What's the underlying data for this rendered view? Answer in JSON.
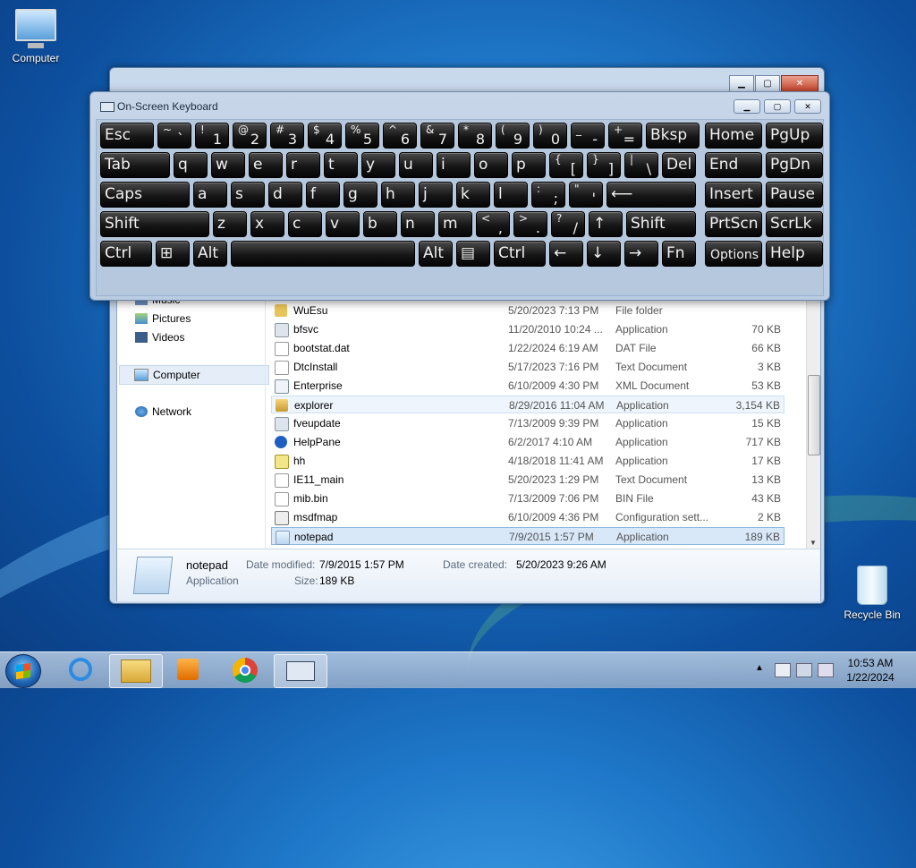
{
  "desktop": {
    "computer_label": "Computer",
    "recycle_bin_label": "Recycle Bin"
  },
  "explorer": {
    "nav": [
      "Music",
      "Pictures",
      "Videos",
      "Computer",
      "Network"
    ],
    "files": [
      {
        "name": "WuEsu",
        "date": "5/20/2023 7:13 PM",
        "type": "File folder",
        "size": ""
      },
      {
        "name": "bfsvc",
        "date": "11/20/2010 10:24 ...",
        "type": "Application",
        "size": "70 KB"
      },
      {
        "name": "bootstat.dat",
        "date": "1/22/2024 6:19 AM",
        "type": "DAT File",
        "size": "66 KB"
      },
      {
        "name": "DtcInstall",
        "date": "5/17/2023 7:16 PM",
        "type": "Text Document",
        "size": "3 KB"
      },
      {
        "name": "Enterprise",
        "date": "6/10/2009 4:30 PM",
        "type": "XML Document",
        "size": "53 KB"
      },
      {
        "name": "explorer",
        "date": "8/29/2016 11:04 AM",
        "type": "Application",
        "size": "3,154 KB"
      },
      {
        "name": "fveupdate",
        "date": "7/13/2009 9:39 PM",
        "type": "Application",
        "size": "15 KB"
      },
      {
        "name": "HelpPane",
        "date": "6/2/2017 4:10 AM",
        "type": "Application",
        "size": "717 KB"
      },
      {
        "name": "hh",
        "date": "4/18/2018 11:41 AM",
        "type": "Application",
        "size": "17 KB"
      },
      {
        "name": "IE11_main",
        "date": "5/20/2023 1:29 PM",
        "type": "Text Document",
        "size": "13 KB"
      },
      {
        "name": "mib.bin",
        "date": "7/13/2009 7:06 PM",
        "type": "BIN File",
        "size": "43 KB"
      },
      {
        "name": "msdfmap",
        "date": "6/10/2009 4:36 PM",
        "type": "Configuration sett...",
        "size": "2 KB"
      },
      {
        "name": "notepad",
        "date": "7/9/2015 1:57 PM",
        "type": "Application",
        "size": "189 KB"
      }
    ],
    "details": {
      "name": "notepad",
      "type": "Application",
      "modified_label": "Date modified:",
      "modified": "7/9/2015 1:57 PM",
      "created_label": "Date created:",
      "created": "5/20/2023 9:26 AM",
      "size_label": "Size:",
      "size": "189 KB"
    }
  },
  "osk": {
    "title": "On-Screen Keyboard",
    "rows": [
      [
        {
          "label": "Esc"
        },
        {
          "top": "~",
          "bot": "`"
        },
        {
          "top": "!",
          "bot": "1"
        },
        {
          "top": "@",
          "bot": "2"
        },
        {
          "top": "#",
          "bot": "3"
        },
        {
          "top": "$",
          "bot": "4"
        },
        {
          "top": "%",
          "bot": "5"
        },
        {
          "top": "^",
          "bot": "6"
        },
        {
          "top": "&",
          "bot": "7"
        },
        {
          "top": "*",
          "bot": "8"
        },
        {
          "top": "(",
          "bot": "9"
        },
        {
          "top": ")",
          "bot": "0"
        },
        {
          "top": "_",
          "bot": "-"
        },
        {
          "top": "+",
          "bot": "="
        },
        {
          "label": "Bksp"
        },
        {
          "label": "Home"
        },
        {
          "label": "PgUp"
        }
      ],
      [
        {
          "label": "Tab"
        },
        {
          "label": "q"
        },
        {
          "label": "w"
        },
        {
          "label": "e"
        },
        {
          "label": "r"
        },
        {
          "label": "t"
        },
        {
          "label": "y"
        },
        {
          "label": "u"
        },
        {
          "label": "i"
        },
        {
          "label": "o"
        },
        {
          "label": "p"
        },
        {
          "top": "{",
          "bot": "["
        },
        {
          "top": "}",
          "bot": "]"
        },
        {
          "top": "|",
          "bot": "\\"
        },
        {
          "label": "Del"
        },
        {
          "label": "End"
        },
        {
          "label": "PgDn"
        }
      ],
      [
        {
          "label": "Caps"
        },
        {
          "label": "a"
        },
        {
          "label": "s"
        },
        {
          "label": "d"
        },
        {
          "label": "f"
        },
        {
          "label": "g"
        },
        {
          "label": "h"
        },
        {
          "label": "j"
        },
        {
          "label": "k"
        },
        {
          "label": "l"
        },
        {
          "top": ":",
          "bot": ";"
        },
        {
          "top": "\"",
          "bot": "'"
        },
        {
          "label": "⟵"
        },
        {
          "label": "Insert"
        },
        {
          "label": "Pause"
        }
      ],
      [
        {
          "label": "Shift"
        },
        {
          "label": "z"
        },
        {
          "label": "x"
        },
        {
          "label": "c"
        },
        {
          "label": "v"
        },
        {
          "label": "b"
        },
        {
          "label": "n"
        },
        {
          "label": "m"
        },
        {
          "top": "<",
          "bot": ","
        },
        {
          "top": ">",
          "bot": "."
        },
        {
          "top": "?",
          "bot": "/"
        },
        {
          "label": "↑"
        },
        {
          "label": "Shift"
        },
        {
          "label": "PrtScn"
        },
        {
          "label": "ScrLk"
        }
      ],
      [
        {
          "label": "Ctrl"
        },
        {
          "label": "⊞"
        },
        {
          "label": "Alt"
        },
        {
          "label": ""
        },
        {
          "label": "Alt"
        },
        {
          "label": "▤"
        },
        {
          "label": "Ctrl"
        },
        {
          "label": "←"
        },
        {
          "label": "↓"
        },
        {
          "label": "→"
        },
        {
          "label": "Fn"
        },
        {
          "label": "Options"
        },
        {
          "label": "Help"
        }
      ]
    ]
  },
  "taskbar": {
    "time": "10:53 AM",
    "date": "1/22/2024"
  }
}
